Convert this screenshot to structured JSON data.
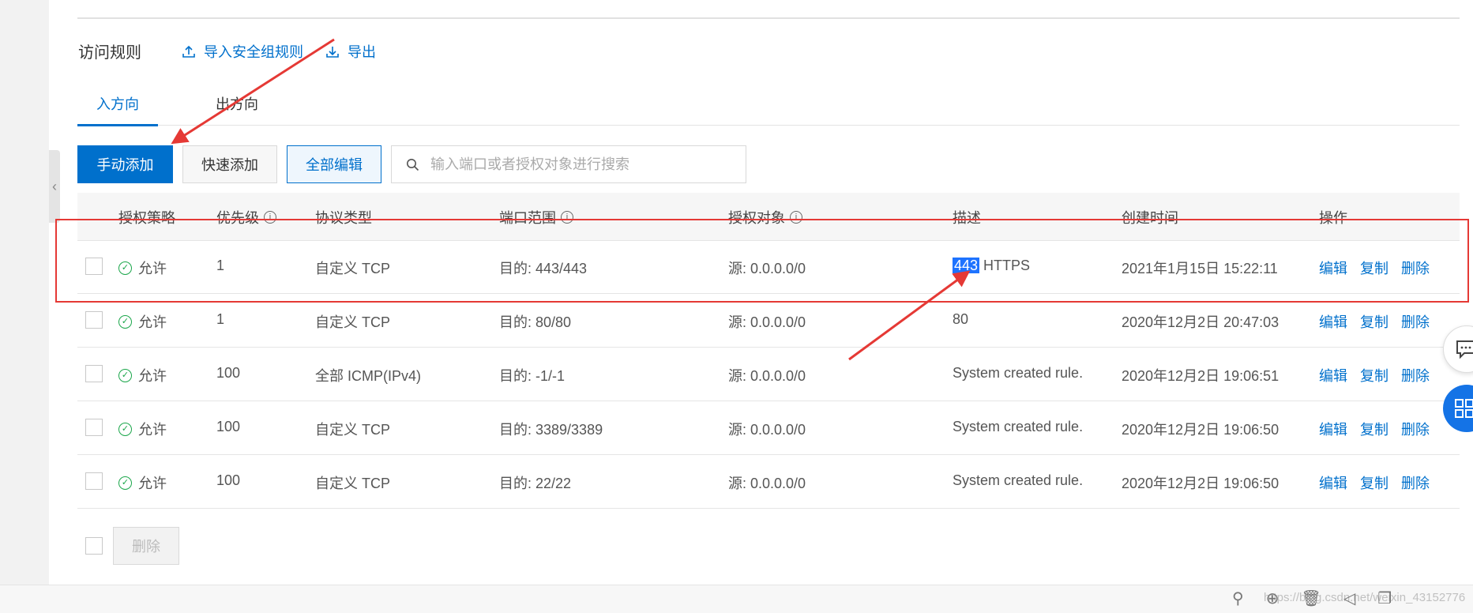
{
  "header": {
    "title": "访问规则",
    "import_link": "导入安全组规则",
    "export_link": "导出"
  },
  "tabs": [
    {
      "label": "入方向",
      "active": true
    },
    {
      "label": "出方向",
      "active": false
    }
  ],
  "toolbar": {
    "manual_add": "手动添加",
    "quick_add": "快速添加",
    "edit_all": "全部编辑",
    "search_placeholder": "输入端口或者授权对象进行搜索"
  },
  "table": {
    "columns": [
      "授权策略",
      "优先级",
      "协议类型",
      "端口范围",
      "授权对象",
      "描述",
      "创建时间",
      "操作"
    ],
    "rows": [
      {
        "policy": "允许",
        "priority": "1",
        "protocol": "自定义 TCP",
        "port": "目的: 443/443",
        "target": "源: 0.0.0.0/0",
        "desc_highlight": "443",
        "desc": " HTTPS",
        "created": "2021年1月15日 15:22:11"
      },
      {
        "policy": "允许",
        "priority": "1",
        "protocol": "自定义 TCP",
        "port": "目的: 80/80",
        "target": "源: 0.0.0.0/0",
        "desc_highlight": "",
        "desc": "80",
        "created": "2020年12月2日 20:47:03"
      },
      {
        "policy": "允许",
        "priority": "100",
        "protocol": "全部 ICMP(IPv4)",
        "port": "目的: -1/-1",
        "target": "源: 0.0.0.0/0",
        "desc_highlight": "",
        "desc": "System created rule.",
        "created": "2020年12月2日 19:06:51"
      },
      {
        "policy": "允许",
        "priority": "100",
        "protocol": "自定义 TCP",
        "port": "目的: 3389/3389",
        "target": "源: 0.0.0.0/0",
        "desc_highlight": "",
        "desc": "System created rule.",
        "created": "2020年12月2日 19:06:50"
      },
      {
        "policy": "允许",
        "priority": "100",
        "protocol": "自定义 TCP",
        "port": "目的: 22/22",
        "target": "源: 0.0.0.0/0",
        "desc_highlight": "",
        "desc": "System created rule.",
        "created": "2020年12月2日 19:06:50"
      }
    ],
    "actions": {
      "edit": "编辑",
      "copy": "复制",
      "delete": "删除"
    }
  },
  "footer": {
    "delete_button": "删除"
  },
  "watermark": "https://blog.csdn.net/weixin_43152776",
  "colors": {
    "accent": "#0070cc",
    "allow": "#1aa64a",
    "annotation": "#e53935"
  }
}
